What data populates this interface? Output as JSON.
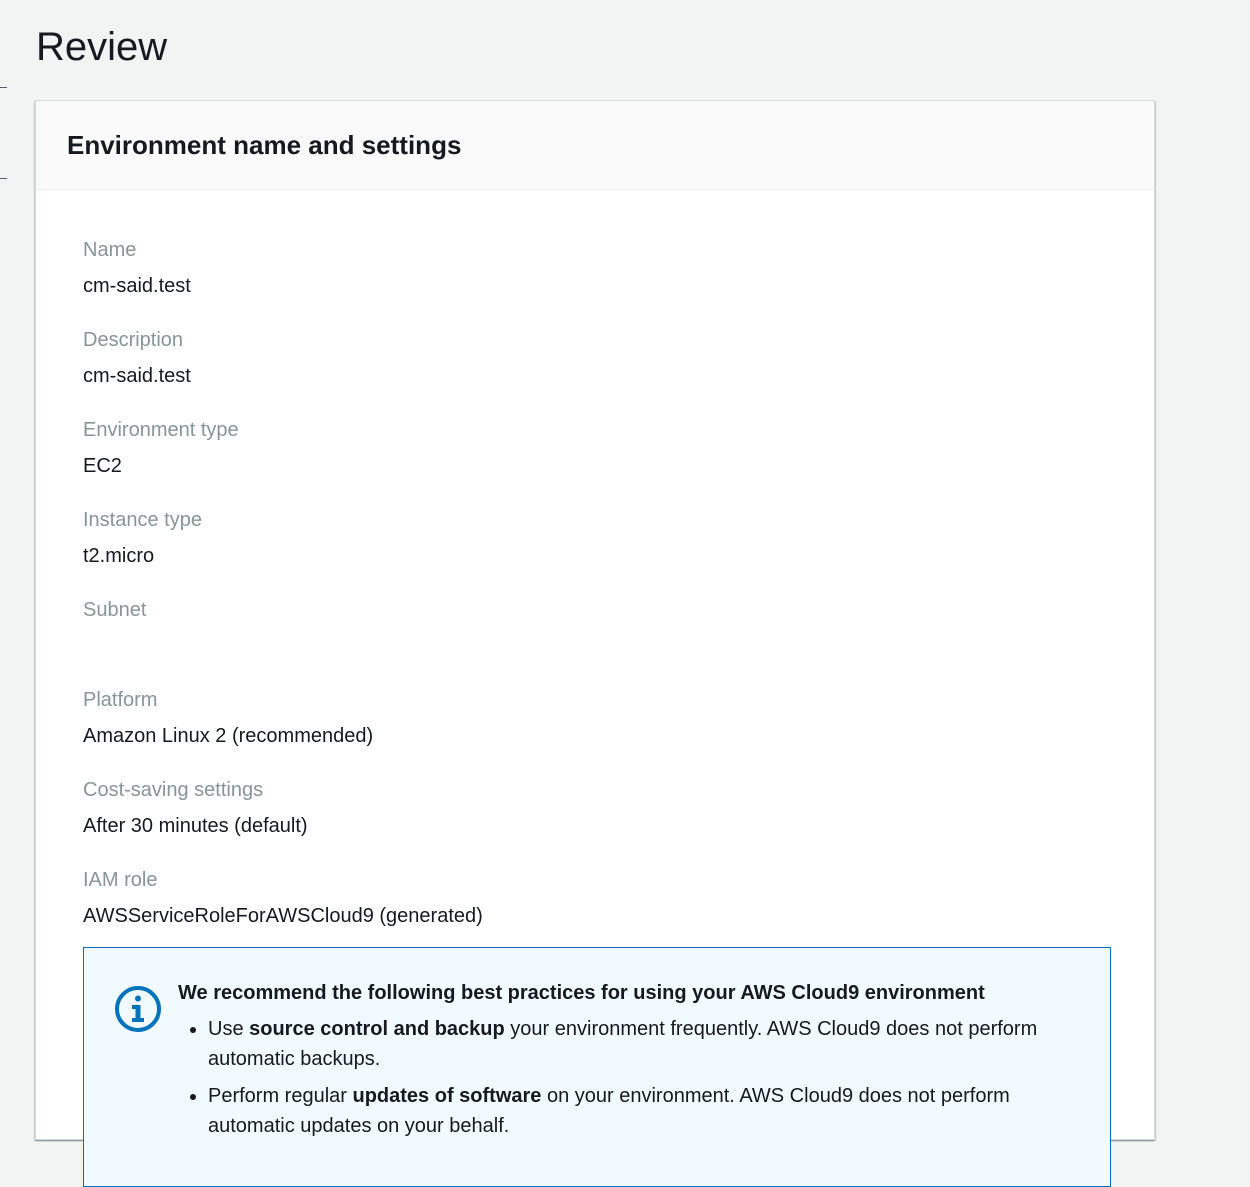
{
  "page": {
    "title": "Review"
  },
  "panel": {
    "title": "Environment name and settings",
    "fields": [
      {
        "label": "Name",
        "value": "cm-said.test"
      },
      {
        "label": "Description",
        "value": "cm-said.test"
      },
      {
        "label": "Environment type",
        "value": "EC2"
      },
      {
        "label": "Instance type",
        "value": "t2.micro"
      },
      {
        "label": "Subnet",
        "value": ""
      },
      {
        "label": "Platform",
        "value": "Amazon Linux 2 (recommended)"
      },
      {
        "label": "Cost-saving settings",
        "value": "After 30 minutes (default)"
      },
      {
        "label": "IAM role",
        "value": "AWSServiceRoleForAWSCloud9 (generated)"
      }
    ]
  },
  "alert": {
    "icon": "info-icon",
    "title": "We recommend the following best practices for using your AWS Cloud9 environment",
    "items": [
      {
        "prefix": "Use ",
        "bold": "source control and backup",
        "suffix": " your environment frequently. AWS Cloud9 does not perform automatic backups."
      },
      {
        "prefix": "Perform regular ",
        "bold": "updates of software",
        "suffix": " on your environment. AWS Cloud9 does not perform automatic updates on your behalf."
      }
    ]
  },
  "colors": {
    "background": "#f2f3f3",
    "panel": "#ffffff",
    "label": "#879596",
    "text": "#16191f",
    "info_accent": "#0073bb",
    "info_background": "#f1faff"
  }
}
